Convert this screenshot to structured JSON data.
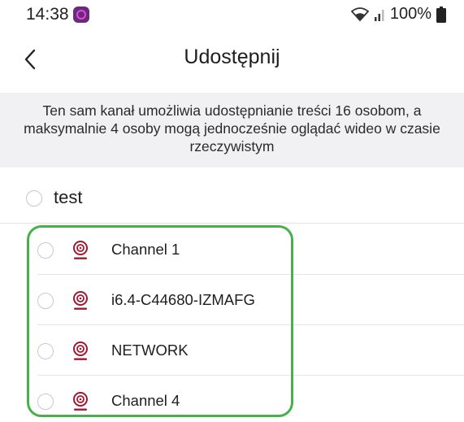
{
  "status_bar": {
    "time": "14:38",
    "battery": "100%",
    "icons": [
      "app-notification-icon",
      "wifi-icon",
      "signal-icon",
      "battery-icon"
    ]
  },
  "header": {
    "back_icon": "chevron-left-icon",
    "title": "Udostępnij"
  },
  "info": {
    "text": "Ten sam kanał umożliwia udostępnianie treści 16 osobom, a maksymalnie 4 osoby mogą jednocześnie oglądać wideo w czasie rzeczywistym"
  },
  "group": {
    "label": "test",
    "selected": false
  },
  "channels": [
    {
      "label": "Channel 1",
      "icon": "camera-icon",
      "selected": false
    },
    {
      "label": "i6.4-C44680-IZMAFG",
      "icon": "camera-icon",
      "selected": false
    },
    {
      "label": "NETWORK",
      "icon": "camera-icon",
      "selected": false
    },
    {
      "label": "Channel 4",
      "icon": "camera-icon",
      "selected": false
    }
  ],
  "colors": {
    "highlight": "#47b04a",
    "banner_bg": "#f1f1f3",
    "camera_icon": "#a0182f"
  }
}
